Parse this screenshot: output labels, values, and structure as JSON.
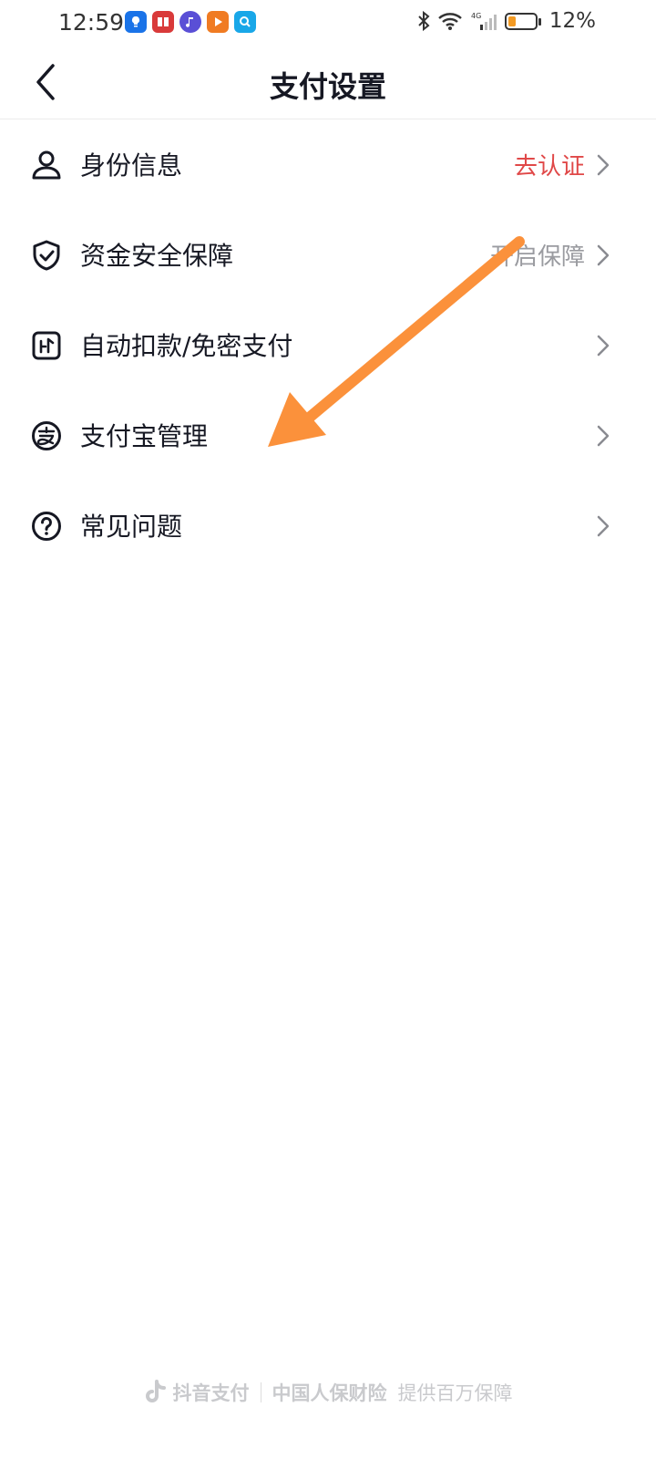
{
  "status_bar": {
    "time": "12:59",
    "battery": "12%",
    "battery_level": 0.12
  },
  "header": {
    "title": "支付设置"
  },
  "items": [
    {
      "label": "身份信息",
      "value": "去认证",
      "value_color": "#e04848",
      "icon": "person-icon"
    },
    {
      "label": "资金安全保障",
      "value": "开启保障",
      "icon": "shield-check-icon"
    },
    {
      "label": "自动扣款/免密支付",
      "value": "",
      "icon": "auto-pay-icon"
    },
    {
      "label": "支付宝管理",
      "value": "",
      "icon": "alipay-icon"
    },
    {
      "label": "常见问题",
      "value": "",
      "icon": "question-icon"
    }
  ],
  "footer": {
    "brand1": "抖音支付",
    "brand2": "中国人保财险",
    "note": "提供百万保障"
  },
  "colors": {
    "annotation_arrow": "#fb913b",
    "accent_red": "#e04848"
  }
}
